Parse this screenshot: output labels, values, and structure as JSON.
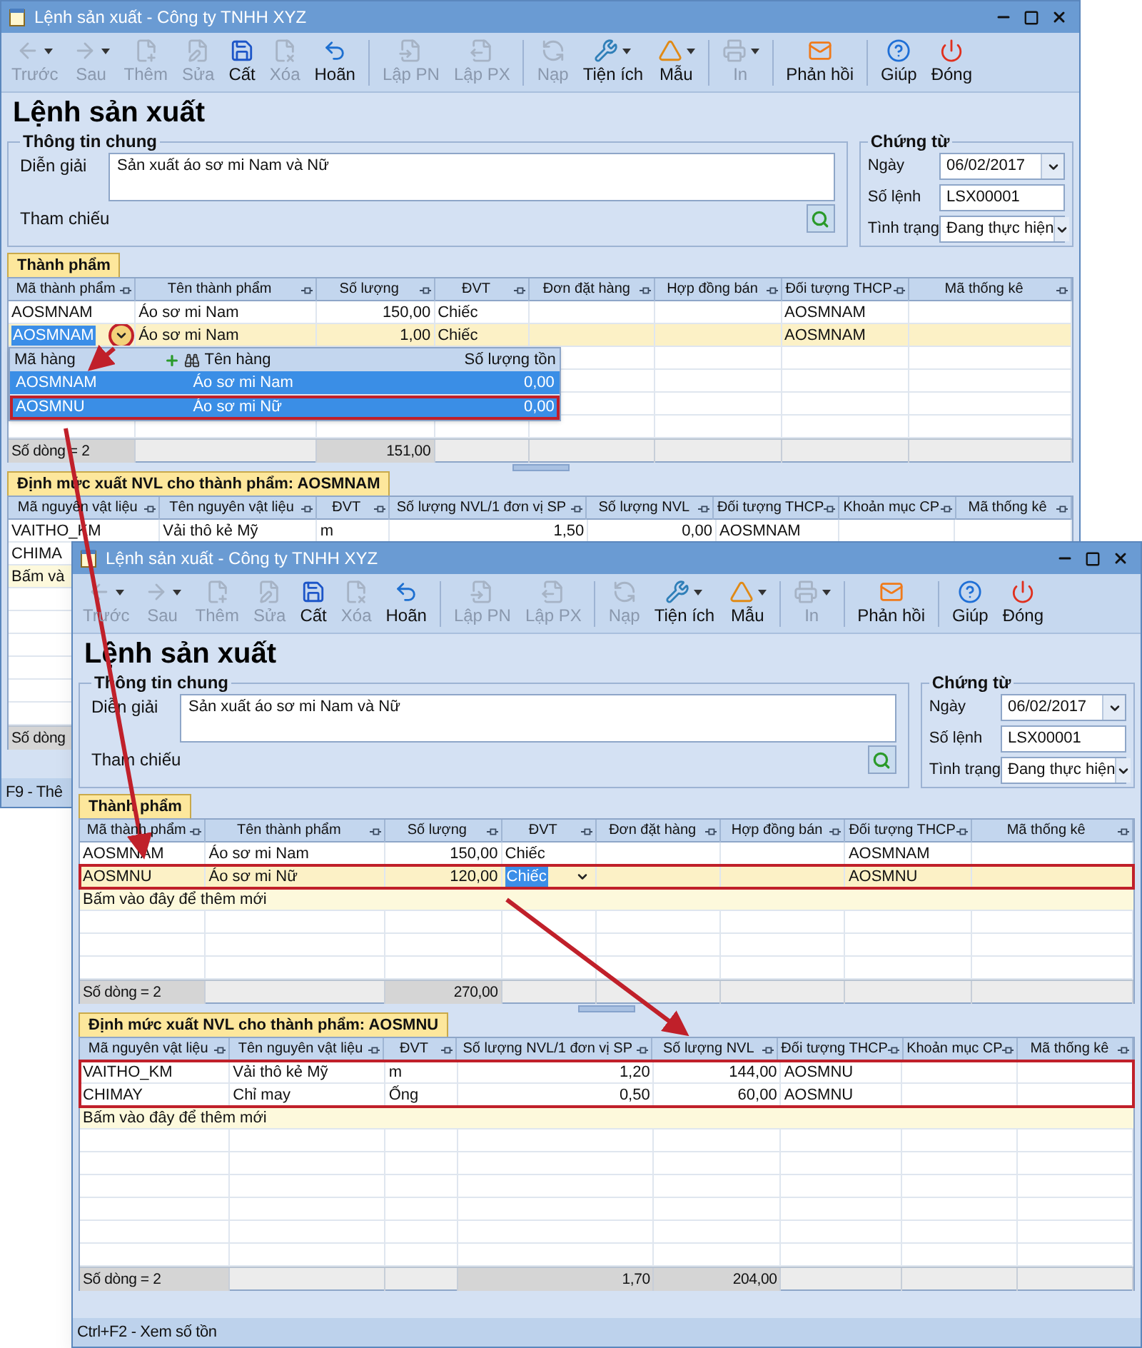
{
  "windows": [
    {
      "title": "Lệnh sản xuất - Công ty TNHH XYZ",
      "toolbar": [
        {
          "kind": "back",
          "label": "Trước",
          "disabled": true,
          "dropdown": true
        },
        {
          "kind": "forward",
          "label": "Sau",
          "disabled": true,
          "dropdown": true
        },
        {
          "kind": "add",
          "label": "Thêm",
          "disabled": true,
          "dropdown": false
        },
        {
          "kind": "edit",
          "label": "Sửa",
          "disabled": true,
          "dropdown": false
        },
        {
          "kind": "save",
          "label": "Cất",
          "disabled": false,
          "dropdown": false
        },
        {
          "kind": "delete",
          "label": "Xóa",
          "disabled": true,
          "dropdown": false
        },
        {
          "kind": "undo",
          "label": "Hoãn",
          "disabled": false,
          "dropdown": false
        },
        {
          "kind": "separator"
        },
        {
          "kind": "receipt",
          "label": "Lập PN",
          "disabled": true,
          "dropdown": false
        },
        {
          "kind": "issue",
          "label": "Lập PX",
          "disabled": true,
          "dropdown": false
        },
        {
          "kind": "separator"
        },
        {
          "kind": "load",
          "label": "Nạp",
          "disabled": true,
          "dropdown": false
        },
        {
          "kind": "tools",
          "label": "Tiện ích",
          "disabled": false,
          "dropdown": true
        },
        {
          "kind": "template",
          "label": "Mẫu",
          "disabled": false,
          "dropdown": true
        },
        {
          "kind": "separator"
        },
        {
          "kind": "print",
          "label": "In",
          "disabled": true,
          "dropdown": true
        },
        {
          "kind": "separator"
        },
        {
          "kind": "feedback",
          "label": "Phản hồi",
          "disabled": false,
          "dropdown": false
        },
        {
          "kind": "separator"
        },
        {
          "kind": "help",
          "label": "Giúp",
          "disabled": false,
          "dropdown": false
        },
        {
          "kind": "close",
          "label": "Đóng",
          "disabled": false,
          "dropdown": false
        }
      ],
      "heading": "Lệnh sản xuất",
      "general": {
        "legend": "Thông tin chung",
        "description_label": "Diễn giải",
        "description": "Sản xuất áo sơ mi Nam và Nữ",
        "reference_label": "Tham chiếu"
      },
      "voucher": {
        "legend": "Chứng từ",
        "date_label": "Ngày",
        "date": "06/02/2017",
        "number_label": "Số lệnh",
        "number": "LSX00001",
        "status_label": "Tình trạng",
        "status": "Đang thực hiện"
      },
      "products": {
        "tab": "Thành phẩm",
        "columns": [
          "Mã thành phẩm",
          "Tên thành phẩm",
          "Số lượng",
          "ĐVT",
          "Đơn đặt hàng",
          "Hợp đồng bán",
          "Đối tượng THCP",
          "Mã thống kê"
        ],
        "rows": [
          {
            "selected": false,
            "highlighted": false,
            "cells": [
              "AOSMNAM",
              "Áo sơ mi Nam",
              "150,00",
              "Chiếc",
              "",
              "",
              "AOSMNAM"
            ]
          },
          {
            "selected": true,
            "highlighted": false,
            "cells": [
              {
                "text": "AOSMNAM",
                "editing": true,
                "circled": true
              },
              "Áo sơ mi Nam",
              "1,00",
              "Chiếc",
              "",
              "",
              "AOSMNAM"
            ]
          }
        ],
        "lookup": {
          "columns": [
            "Mã hàng",
            "Tên hàng",
            "Số lượng tồn"
          ],
          "rows": [
            {
              "selected": true,
              "highlighted": false,
              "cells": [
                "AOSMNAM",
                "Áo sơ mi Nam",
                "0,00"
              ]
            },
            {
              "selected": true,
              "highlighted": true,
              "cells": [
                "AOSMNU",
                "Áo sơ mi Nữ",
                "0,00"
              ]
            }
          ]
        },
        "footer": {
          "label": "Số dòng = 2",
          "quantity": "151,00"
        }
      },
      "materials": {
        "tab": "Định mức xuất NVL cho thành phẩm: AOSMNAM",
        "columns": [
          "Mã nguyên vật liệu",
          "Tên nguyên vật liệu",
          "ĐVT",
          "Số lượng NVL/1 đơn vị SP",
          "Số lượng NVL",
          "Đối tượng THCP",
          "Khoản mục CP",
          "Mã thống kê"
        ],
        "rows": [
          {
            "selected": false,
            "highlighted": false,
            "cells": [
              "VAITHO_KM",
              "Vải thô kẻ Mỹ",
              "m",
              "1,50",
              "0,00",
              "AOSMNAM"
            ]
          },
          {
            "selected": false,
            "highlighted": false,
            "cells": [
              "CHIMA"
            ]
          }
        ],
        "new_row_hint": "Bấm và",
        "footer": {
          "label": "Số dòng"
        }
      },
      "status_bar": "F9 - Thê"
    },
    {
      "title": "Lệnh sản xuất - Công ty TNHH XYZ",
      "toolbar": [
        {
          "kind": "back",
          "label": "Trước",
          "disabled": true,
          "dropdown": true
        },
        {
          "kind": "forward",
          "label": "Sau",
          "disabled": true,
          "dropdown": true
        },
        {
          "kind": "add",
          "label": "Thêm",
          "disabled": true,
          "dropdown": false
        },
        {
          "kind": "edit",
          "label": "Sửa",
          "disabled": true,
          "dropdown": false
        },
        {
          "kind": "save",
          "label": "Cất",
          "disabled": false,
          "dropdown": false
        },
        {
          "kind": "delete",
          "label": "Xóa",
          "disabled": true,
          "dropdown": false
        },
        {
          "kind": "undo",
          "label": "Hoãn",
          "disabled": false,
          "dropdown": false
        },
        {
          "kind": "separator"
        },
        {
          "kind": "receipt",
          "label": "Lập PN",
          "disabled": true,
          "dropdown": false
        },
        {
          "kind": "issue",
          "label": "Lập PX",
          "disabled": true,
          "dropdown": false
        },
        {
          "kind": "separator"
        },
        {
          "kind": "load",
          "label": "Nạp",
          "disabled": true,
          "dropdown": false
        },
        {
          "kind": "tools",
          "label": "Tiện ích",
          "disabled": false,
          "dropdown": true
        },
        {
          "kind": "template",
          "label": "Mẫu",
          "disabled": false,
          "dropdown": true
        },
        {
          "kind": "separator"
        },
        {
          "kind": "print",
          "label": "In",
          "disabled": true,
          "dropdown": true
        },
        {
          "kind": "separator"
        },
        {
          "kind": "feedback",
          "label": "Phản hồi",
          "disabled": false,
          "dropdown": false
        },
        {
          "kind": "separator"
        },
        {
          "kind": "help",
          "label": "Giúp",
          "disabled": false,
          "dropdown": false
        },
        {
          "kind": "close",
          "label": "Đóng",
          "disabled": false,
          "dropdown": false
        }
      ],
      "heading": "Lệnh sản xuất",
      "general": {
        "legend": "Thông tin chung",
        "description_label": "Diễn giải",
        "description": "Sản xuất áo sơ mi Nam và Nữ",
        "reference_label": "Tham chiếu"
      },
      "voucher": {
        "legend": "Chứng từ",
        "date_label": "Ngày",
        "date": "06/02/2017",
        "number_label": "Số lệnh",
        "number": "LSX00001",
        "status_label": "Tình trạng",
        "status": "Đang thực hiện"
      },
      "products": {
        "tab": "Thành phẩm",
        "columns": [
          "Mã thành phẩm",
          "Tên thành phẩm",
          "Số lượng",
          "ĐVT",
          "Đơn đặt hàng",
          "Hợp đồng bán",
          "Đối tượng THCP",
          "Mã thống kê"
        ],
        "rows": [
          {
            "selected": false,
            "highlighted": false,
            "cells": [
              "AOSMNAM",
              "Áo sơ mi Nam",
              "150,00",
              "Chiếc",
              "",
              "",
              "AOSMNAM"
            ]
          },
          {
            "selected": true,
            "highlighted": true,
            "cells": [
              "AOSMNU",
              "Áo sơ mi Nữ",
              "120,00",
              {
                "text": "Chiếc",
                "editing": true,
                "circled": false
              },
              "",
              "",
              "AOSMNU"
            ]
          }
        ],
        "new_row_hint": "Bấm vào đây để thêm mới",
        "footer": {
          "label": "Số dòng = 2",
          "quantity": "270,00"
        }
      },
      "materials": {
        "tab": "Định mức xuất NVL cho thành phẩm: AOSMNU",
        "columns": [
          "Mã nguyên vật liệu",
          "Tên nguyên vật liệu",
          "ĐVT",
          "Số lượng NVL/1 đơn vị SP",
          "Số lượng NVL",
          "Đối tượng THCP",
          "Khoản mục CP",
          "Mã thống kê"
        ],
        "rows": [
          {
            "selected": false,
            "highlighted": true,
            "cells": [
              "VAITHO_KM",
              "Vải thô kẻ Mỹ",
              "m",
              "1,20",
              "144,00",
              "AOSMNU"
            ]
          },
          {
            "selected": false,
            "highlighted": true,
            "cells": [
              "CHIMAY",
              "Chỉ may",
              "Ống",
              "0,50",
              "60,00",
              "AOSMNU"
            ]
          }
        ],
        "new_row_hint": "Bấm vào đây để thêm mới",
        "footer": {
          "label": "Số dòng = 2",
          "per_unit": "1,70",
          "quantity": "204,00"
        }
      },
      "status_bar": "Ctrl+F2 - Xem số tồn"
    }
  ]
}
